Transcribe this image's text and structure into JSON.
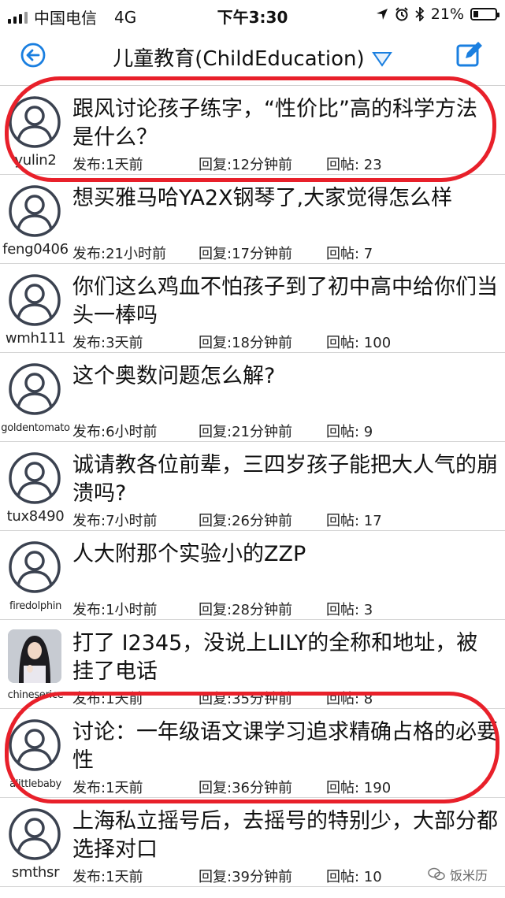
{
  "status": {
    "carrier": "中国电信",
    "network": "4G",
    "time": "下午3:30",
    "battery": "21%"
  },
  "nav": {
    "title": "儿童教育(ChildEducation)"
  },
  "posts": [
    {
      "user": "yulin2",
      "title": "跟风讨论孩子练字，“性价比”高的科学方法是什么？",
      "posted": "发布:1天前",
      "reply": "回复:12分钟前",
      "count": "回帖: 23",
      "avatar": "default"
    },
    {
      "user": "feng0406",
      "title": "想买雅马哈YA2X钢琴了,大家觉得怎么样",
      "posted": "发布:21小时前",
      "reply": "回复:17分钟前",
      "count": "回帖: 7",
      "avatar": "default"
    },
    {
      "user": "wmh111",
      "title": "你们这么鸡血不怕孩子到了初中高中给你们当头一棒吗",
      "posted": "发布:3天前",
      "reply": "回复:18分钟前",
      "count": "回帖: 100",
      "avatar": "default"
    },
    {
      "user": "goldentomato",
      "title": "这个奥数问题怎么解?",
      "posted": "发布:6小时前",
      "reply": "回复:21分钟前",
      "count": "回帖: 9",
      "avatar": "default"
    },
    {
      "user": "tux8490",
      "title": "诚请教各位前辈，三四岁孩子能把大人气的崩溃吗?",
      "posted": "发布:7小时前",
      "reply": "回复:26分钟前",
      "count": "回帖: 17",
      "avatar": "default"
    },
    {
      "user": "firedolphin",
      "title": "人大附那个实验小的ZZP",
      "posted": "发布:1小时前",
      "reply": "回复:28分钟前",
      "count": "回帖: 3",
      "avatar": "default"
    },
    {
      "user": "chineserice",
      "title": "打了 I2345，没说上LILY的全称和地址，被挂了电话",
      "posted": "发布:1天前",
      "reply": "回复:35分钟前",
      "count": "回帖: 8",
      "avatar": "photo"
    },
    {
      "user": "alittlebaby",
      "title": "讨论：一年级语文课学习追求精确占格的必要性",
      "posted": "发布:1天前",
      "reply": "回复:36分钟前",
      "count": "回帖: 190",
      "avatar": "default"
    },
    {
      "user": "smthsr",
      "title": "上海私立摇号后，去摇号的特别少，大部分都选择对口",
      "posted": "发布:1天前",
      "reply": "回复:39分钟前",
      "count": "回帖: 10",
      "avatar": "default"
    }
  ],
  "watermark": "饭米历",
  "colors": {
    "accent": "#1a7fe0",
    "annotation": "#e8202a",
    "avatar_stroke": "#3b4250"
  },
  "icons": {
    "back": "back-arrow-circle-icon",
    "compose": "compose-edit-icon",
    "dropdown": "triangle-down-icon",
    "avatar": "user-avatar-icon"
  }
}
